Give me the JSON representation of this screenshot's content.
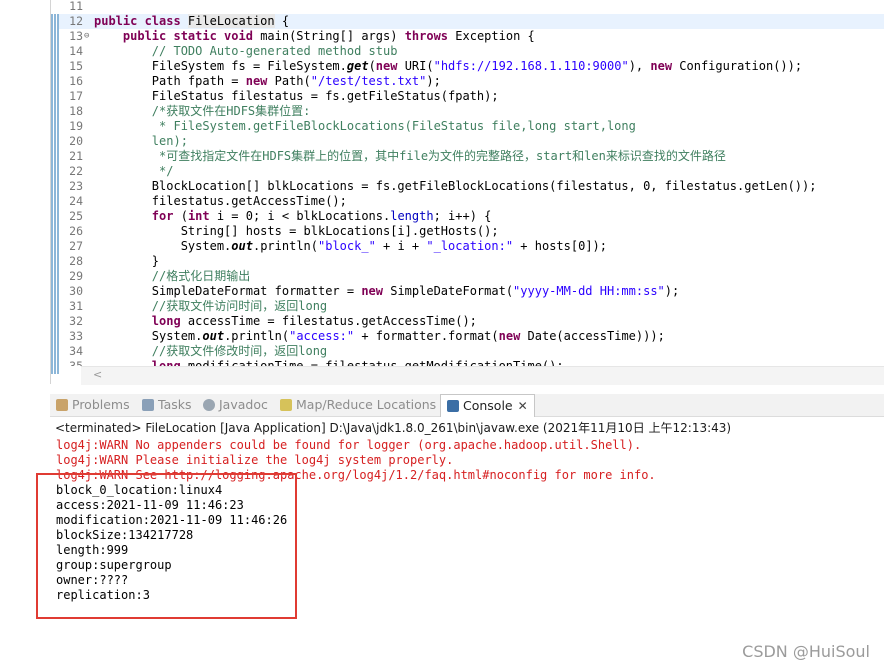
{
  "editor": {
    "lines": [
      {
        "n": "11",
        "segs": []
      },
      {
        "n": "12",
        "segs": [
          {
            "c": "kw",
            "t": "public class "
          },
          {
            "c": "hl",
            "t": "FileLo"
          },
          {
            "c": "hl",
            "t": "cation"
          },
          {
            "c": "",
            "t": " {"
          }
        ]
      },
      {
        "n": "13",
        "fold": "⊖",
        "segs": [
          {
            "c": "",
            "t": "    "
          },
          {
            "c": "kw",
            "t": "public static void "
          },
          {
            "c": "",
            "t": "main(String[] args) "
          },
          {
            "c": "kw",
            "t": "throws "
          },
          {
            "c": "",
            "t": "Exception {"
          }
        ]
      },
      {
        "n": "14",
        "segs": [
          {
            "c": "",
            "t": "        "
          },
          {
            "c": "cm",
            "t": "// TODO Auto-generated method stub"
          }
        ]
      },
      {
        "n": "15",
        "segs": [
          {
            "c": "",
            "t": "        FileSystem fs = FileSystem."
          },
          {
            "c": "sm",
            "t": "get"
          },
          {
            "c": "",
            "t": "("
          },
          {
            "c": "kw",
            "t": "new "
          },
          {
            "c": "",
            "t": "URI("
          },
          {
            "c": "st",
            "t": "\"hdfs://192.168.1.110:9000\""
          },
          {
            "c": "",
            "t": "), "
          },
          {
            "c": "kw",
            "t": "new "
          },
          {
            "c": "",
            "t": "Configuration());"
          }
        ]
      },
      {
        "n": "16",
        "segs": [
          {
            "c": "",
            "t": "        Path fpath = "
          },
          {
            "c": "kw",
            "t": "new "
          },
          {
            "c": "",
            "t": "Path("
          },
          {
            "c": "st",
            "t": "\"/test/test.txt\""
          },
          {
            "c": "",
            "t": ");"
          }
        ]
      },
      {
        "n": "17",
        "segs": [
          {
            "c": "",
            "t": "        FileStatus filestatus = fs.getFileStatus(fpath);"
          }
        ]
      },
      {
        "n": "18",
        "segs": [
          {
            "c": "",
            "t": "        "
          },
          {
            "c": "cm",
            "t": "/*获取文件在HDFS集群位置:"
          }
        ]
      },
      {
        "n": "19",
        "segs": [
          {
            "c": "",
            "t": "         "
          },
          {
            "c": "cm",
            "t": "* FileSystem.getFileBlockLocations(FileStatus file,long start,long"
          }
        ]
      },
      {
        "n": "20",
        "segs": [
          {
            "c": "",
            "t": "        "
          },
          {
            "c": "cm",
            "t": "len);"
          }
        ]
      },
      {
        "n": "21",
        "segs": [
          {
            "c": "",
            "t": "         "
          },
          {
            "c": "cm",
            "t": "*可查找指定文件在HDFS集群上的位置，其中file为文件的完整路径，start和len来标识查找的文件路径"
          }
        ]
      },
      {
        "n": "22",
        "segs": [
          {
            "c": "",
            "t": "         "
          },
          {
            "c": "cm",
            "t": "*/"
          }
        ]
      },
      {
        "n": "23",
        "segs": [
          {
            "c": "",
            "t": "        BlockLocation[] blkLocations = fs.getFileBlockLocations(filestatus, 0, filestatus.getLen());"
          }
        ]
      },
      {
        "n": "24",
        "segs": [
          {
            "c": "",
            "t": "        filestatus.getAccessTime();"
          }
        ]
      },
      {
        "n": "25",
        "segs": [
          {
            "c": "",
            "t": "        "
          },
          {
            "c": "kw",
            "t": "for "
          },
          {
            "c": "",
            "t": "("
          },
          {
            "c": "kw",
            "t": "int "
          },
          {
            "c": "",
            "t": "i = 0; i < blkLocations."
          },
          {
            "c": "fld",
            "t": "length"
          },
          {
            "c": "",
            "t": "; i++) {"
          }
        ]
      },
      {
        "n": "26",
        "segs": [
          {
            "c": "",
            "t": "            String[] hosts = blkLocations[i].getHosts();"
          }
        ]
      },
      {
        "n": "27",
        "segs": [
          {
            "c": "",
            "t": "            System."
          },
          {
            "c": "sm",
            "t": "out"
          },
          {
            "c": "",
            "t": ".println("
          },
          {
            "c": "st",
            "t": "\"block_\""
          },
          {
            "c": "",
            "t": " + i + "
          },
          {
            "c": "st",
            "t": "\"_location:\""
          },
          {
            "c": "",
            "t": " + hosts[0]);"
          }
        ]
      },
      {
        "n": "28",
        "segs": [
          {
            "c": "",
            "t": "        }"
          }
        ]
      },
      {
        "n": "29",
        "segs": [
          {
            "c": "",
            "t": "        "
          },
          {
            "c": "cm",
            "t": "//格式化日期输出"
          }
        ]
      },
      {
        "n": "30",
        "segs": [
          {
            "c": "",
            "t": "        SimpleDateFormat formatter = "
          },
          {
            "c": "kw",
            "t": "new "
          },
          {
            "c": "",
            "t": "SimpleDateFormat("
          },
          {
            "c": "st",
            "t": "\"yyyy-MM-dd HH:mm:ss\""
          },
          {
            "c": "",
            "t": ");"
          }
        ]
      },
      {
        "n": "31",
        "segs": [
          {
            "c": "",
            "t": "        "
          },
          {
            "c": "cm",
            "t": "//获取文件访问时间，返回long"
          }
        ]
      },
      {
        "n": "32",
        "segs": [
          {
            "c": "",
            "t": "        "
          },
          {
            "c": "kw",
            "t": "long "
          },
          {
            "c": "",
            "t": "accessTime = filestatus.getAccessTime();"
          }
        ]
      },
      {
        "n": "33",
        "segs": [
          {
            "c": "",
            "t": "        System."
          },
          {
            "c": "sm",
            "t": "out"
          },
          {
            "c": "",
            "t": ".println("
          },
          {
            "c": "st",
            "t": "\"access:\""
          },
          {
            "c": "",
            "t": " + formatter.format("
          },
          {
            "c": "kw",
            "t": "new "
          },
          {
            "c": "",
            "t": "Date(accessTime)));"
          }
        ]
      },
      {
        "n": "34",
        "segs": [
          {
            "c": "",
            "t": "        "
          },
          {
            "c": "cm",
            "t": "//获取文件修改时间，返回long"
          }
        ]
      },
      {
        "n": "35",
        "segs": [
          {
            "c": "",
            "t": "        "
          },
          {
            "c": "kw",
            "t": "long "
          },
          {
            "c": "",
            "t": "modificationTime = filestatus.getModificationTime();"
          }
        ]
      }
    ],
    "scroll_left_arrow": "<"
  },
  "views": {
    "tabs": [
      {
        "label": "Problems",
        "icon": "problems-icon"
      },
      {
        "label": "Tasks",
        "icon": "tasks-icon"
      },
      {
        "label": "Javadoc",
        "icon": "javadoc-icon"
      },
      {
        "label": "Map/Reduce Locations",
        "icon": "mapreduce-icon"
      },
      {
        "label": "Console",
        "icon": "console-icon",
        "active": true,
        "close": "✕"
      }
    ],
    "terminated": "<terminated> FileLocation [Java Application] D:\\Java\\jdk1.8.0_261\\bin\\javaw.exe (2021年11月10日 上午12:13:43)"
  },
  "console": {
    "lines": [
      {
        "kind": "err",
        "text": "log4j:WARN No appenders could be found for logger (org.apache.hadoop.util.Shell)."
      },
      {
        "kind": "err",
        "text": "log4j:WARN Please initialize the log4j system properly."
      },
      {
        "kind": "err",
        "text": "log4j:WARN See http://logging.apache.org/log4j/1.2/faq.html#noconfig for more info."
      },
      {
        "kind": "out",
        "text": "block_0_location:linux4"
      },
      {
        "kind": "out",
        "text": "access:2021-11-09 11:46:23"
      },
      {
        "kind": "out",
        "text": "modification:2021-11-09 11:46:26"
      },
      {
        "kind": "out",
        "text": "blockSize:134217728"
      },
      {
        "kind": "out",
        "text": "length:999"
      },
      {
        "kind": "out",
        "text": "group:supergroup"
      },
      {
        "kind": "out",
        "text": "owner:????"
      },
      {
        "kind": "out",
        "text": "replication:3"
      }
    ]
  },
  "watermark": "CSDN @HuiSoul",
  "colors": {
    "keyword": "#7f0055",
    "comment": "#3f7f5f",
    "string": "#2a00ff",
    "error": "#d62021",
    "highlight_box": "#e03b33"
  }
}
